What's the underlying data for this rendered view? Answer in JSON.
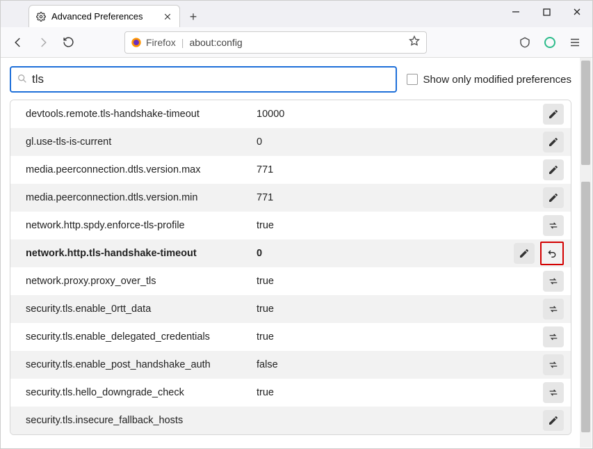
{
  "tab": {
    "title": "Advanced Preferences"
  },
  "urlbar": {
    "identity": "Firefox",
    "address": "about:config"
  },
  "search": {
    "query": "tls"
  },
  "filter": {
    "show_modified_label": "Show only modified preferences",
    "checked": false
  },
  "prefs": [
    {
      "name": "devtools.remote.tls-handshake-timeout",
      "value": "10000",
      "action": "edit",
      "modified": false
    },
    {
      "name": "gl.use-tls-is-current",
      "value": "0",
      "action": "edit",
      "modified": false
    },
    {
      "name": "media.peerconnection.dtls.version.max",
      "value": "771",
      "action": "edit",
      "modified": false
    },
    {
      "name": "media.peerconnection.dtls.version.min",
      "value": "771",
      "action": "edit",
      "modified": false
    },
    {
      "name": "network.http.spdy.enforce-tls-profile",
      "value": "true",
      "action": "toggle",
      "modified": false
    },
    {
      "name": "network.http.tls-handshake-timeout",
      "value": "0",
      "action": "edit",
      "modified": true
    },
    {
      "name": "network.proxy.proxy_over_tls",
      "value": "true",
      "action": "toggle",
      "modified": false
    },
    {
      "name": "security.tls.enable_0rtt_data",
      "value": "true",
      "action": "toggle",
      "modified": false
    },
    {
      "name": "security.tls.enable_delegated_credentials",
      "value": "true",
      "action": "toggle",
      "modified": false
    },
    {
      "name": "security.tls.enable_post_handshake_auth",
      "value": "false",
      "action": "toggle",
      "modified": false
    },
    {
      "name": "security.tls.hello_downgrade_check",
      "value": "true",
      "action": "toggle",
      "modified": false
    },
    {
      "name": "security.tls.insecure_fallback_hosts",
      "value": "",
      "action": "edit",
      "modified": false
    }
  ]
}
